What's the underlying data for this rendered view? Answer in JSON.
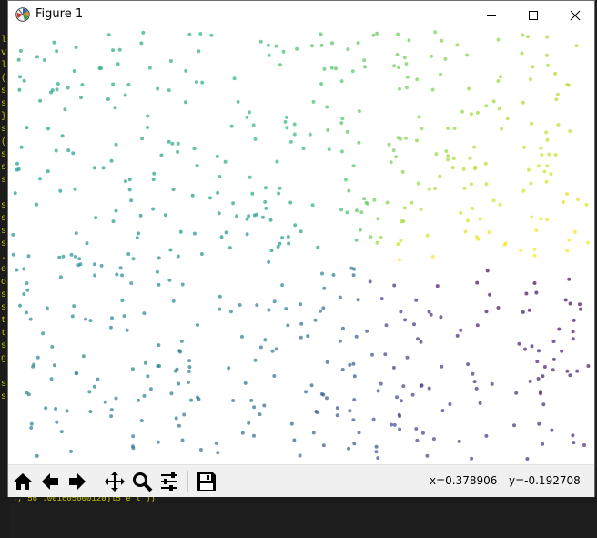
{
  "window": {
    "title": "Figure 1"
  },
  "controls": {
    "minimize": "—",
    "maximize": "☐",
    "close": "✕"
  },
  "console": {
    "left_glyphs": [
      "l",
      "v",
      "l",
      "(",
      "s",
      "s",
      "}",
      "s",
      "(",
      "s",
      "s",
      "s",
      "",
      "s",
      "s",
      "s",
      "s",
      ".",
      "o",
      "o",
      "s",
      "s",
      "t",
      "t",
      "s",
      "g",
      "",
      "s",
      "s"
    ],
    "bottom_text": "  ., 56 .001605000120)l5 e l  ))"
  },
  "toolbar": {
    "buttons": [
      "home-icon",
      "back-icon",
      "forward-icon",
      "pan-icon",
      "zoom-icon",
      "configure-subplots-icon",
      "save-icon"
    ]
  },
  "status": {
    "x_readout": "x=0.378906",
    "y_readout": "y=-0.192708"
  },
  "colors": {
    "accent_cmap": "viridis",
    "marker_alpha": 0.7
  }
}
